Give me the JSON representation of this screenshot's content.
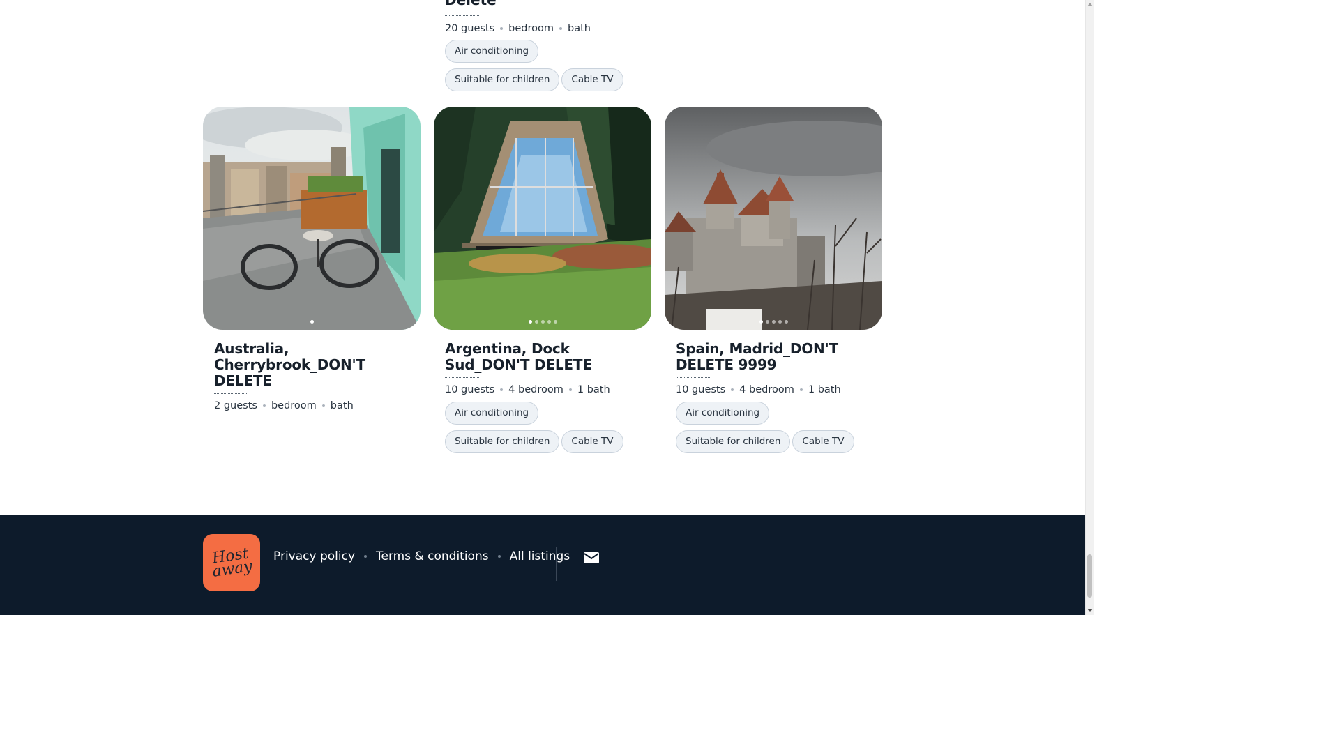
{
  "top_listing": {
    "title_tail": "Delete",
    "meta": [
      "20 guests",
      "bedroom",
      "bath"
    ],
    "amenities_row1": [
      "Air conditioning"
    ],
    "amenities_row2": [
      "Suitable for children",
      "Cable TV"
    ]
  },
  "listings": [
    {
      "title": "Australia, Cherrybrook_DON'T DELETE",
      "meta": [
        "2 guests",
        "bedroom",
        "bath"
      ],
      "photo_icon": "balcony-photo",
      "dots_total": 1,
      "amenities_row1": [],
      "amenities_row2": []
    },
    {
      "title": "Argentina, Dock Sud_DON'T DELETE",
      "meta": [
        "10 guests",
        "4 bedroom",
        "1 bath"
      ],
      "photo_icon": "glass-cabin-photo",
      "dots_total": 5,
      "amenities_row1": [
        "Air conditioning"
      ],
      "amenities_row2": [
        "Suitable for children",
        "Cable TV"
      ]
    },
    {
      "title": "Spain, Madrid_DON'T DELETE 9999",
      "meta": [
        "10 guests",
        "4 bedroom",
        "1 bath"
      ],
      "photo_icon": "castle-photo",
      "dots_total": 5,
      "amenities_row1": [
        "Air conditioning"
      ],
      "amenities_row2": [
        "Suitable for children",
        "Cable TV"
      ]
    }
  ],
  "footer": {
    "logo_text": "Host away",
    "links": [
      "Privacy policy",
      "Terms & conditions",
      "All listings"
    ],
    "mail_icon": "envelope-icon"
  },
  "colors": {
    "footer_bg": "#0d1b2b",
    "logo_bg": "#f46d43",
    "chip_bg": "#eef2f6",
    "chip_border": "#c9d2dc"
  }
}
